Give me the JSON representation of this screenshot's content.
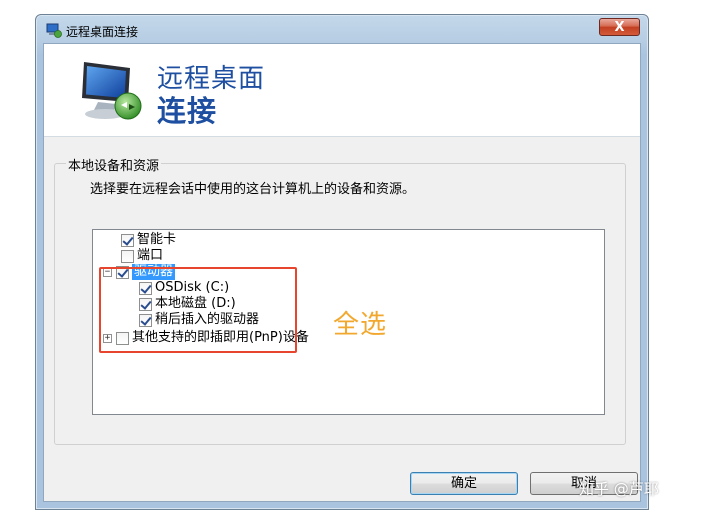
{
  "window": {
    "title": "远程桌面连接",
    "close_label": "X"
  },
  "banner": {
    "line1": "远程桌面",
    "line2": "连接"
  },
  "group": {
    "legend": "本地设备和资源",
    "description": "选择要在远程会话中使用的这台计算机上的设备和资源。"
  },
  "tree": {
    "items": [
      {
        "label": "智能卡",
        "checked": true
      },
      {
        "label": "端口",
        "checked": false
      },
      {
        "label": "驱动器",
        "checked": true,
        "expander": "−",
        "selected": true
      },
      {
        "label": "OSDisk (C:)",
        "checked": true
      },
      {
        "label": "本地磁盘 (D:)",
        "checked": true
      },
      {
        "label": "稍后插入的驱动器",
        "checked": true
      },
      {
        "label": "其他支持的即插即用(PnP)设备",
        "checked": false,
        "expander": "+"
      }
    ]
  },
  "annotation": {
    "text": "全选",
    "box_color": "#e8452e",
    "text_color": "#f2a82e"
  },
  "buttons": {
    "ok": "确定",
    "cancel": "取消"
  },
  "watermark": "知乎 @芦耶",
  "colors": {
    "title_blue": "#1e4fa0",
    "selection": "#3399ff"
  }
}
